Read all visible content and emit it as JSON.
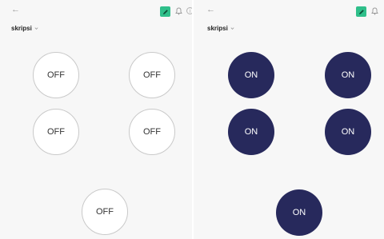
{
  "left_screen": {
    "back_glyph": "←",
    "title": "skripsi",
    "info_glyph": "i",
    "buttons": [
      {
        "label": "OFF"
      },
      {
        "label": "OFF"
      },
      {
        "label": "OFF"
      },
      {
        "label": "OFF"
      },
      {
        "label": "OFF"
      }
    ]
  },
  "right_screen": {
    "back_glyph": "←",
    "title": "skripsi",
    "buttons": [
      {
        "label": "ON"
      },
      {
        "label": "ON"
      },
      {
        "label": "ON"
      },
      {
        "label": "ON"
      },
      {
        "label": "ON"
      }
    ]
  },
  "icons": {
    "back": "arrow-left-icon",
    "edit": "pencil-icon",
    "bell": "bell-icon",
    "info": "info-icon",
    "dropdown": "chevron-down-icon"
  },
  "colors": {
    "edit_button": "#2fbf8a",
    "on_fill": "#27295c",
    "off_border": "#c9c9c9"
  }
}
